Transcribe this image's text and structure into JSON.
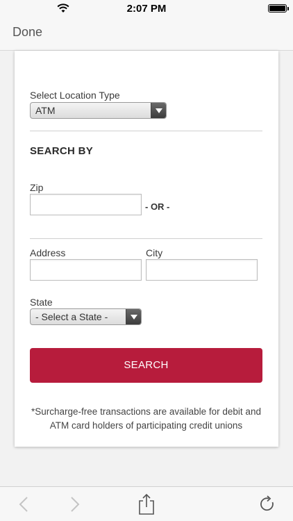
{
  "status_bar": {
    "time": "2:07 PM"
  },
  "nav": {
    "done_label": "Done"
  },
  "form": {
    "location_type_label": "Select Location Type",
    "location_type_value": "ATM",
    "search_by_heading": "SEARCH BY",
    "zip_label": "Zip",
    "zip_value": "",
    "or_text": "- OR -",
    "address_label": "Address",
    "address_value": "",
    "city_label": "City",
    "city_value": "",
    "state_label": "State",
    "state_value": "- Select a State -",
    "search_button_label": "SEARCH",
    "footnote": "*Surcharge-free transactions are available for debit and ATM card holders of participating credit unions"
  },
  "colors": {
    "accent": "#b71c3c"
  },
  "toolbar": {
    "icons": [
      "back-icon",
      "forward-icon",
      "share-icon",
      "reload-icon"
    ]
  }
}
